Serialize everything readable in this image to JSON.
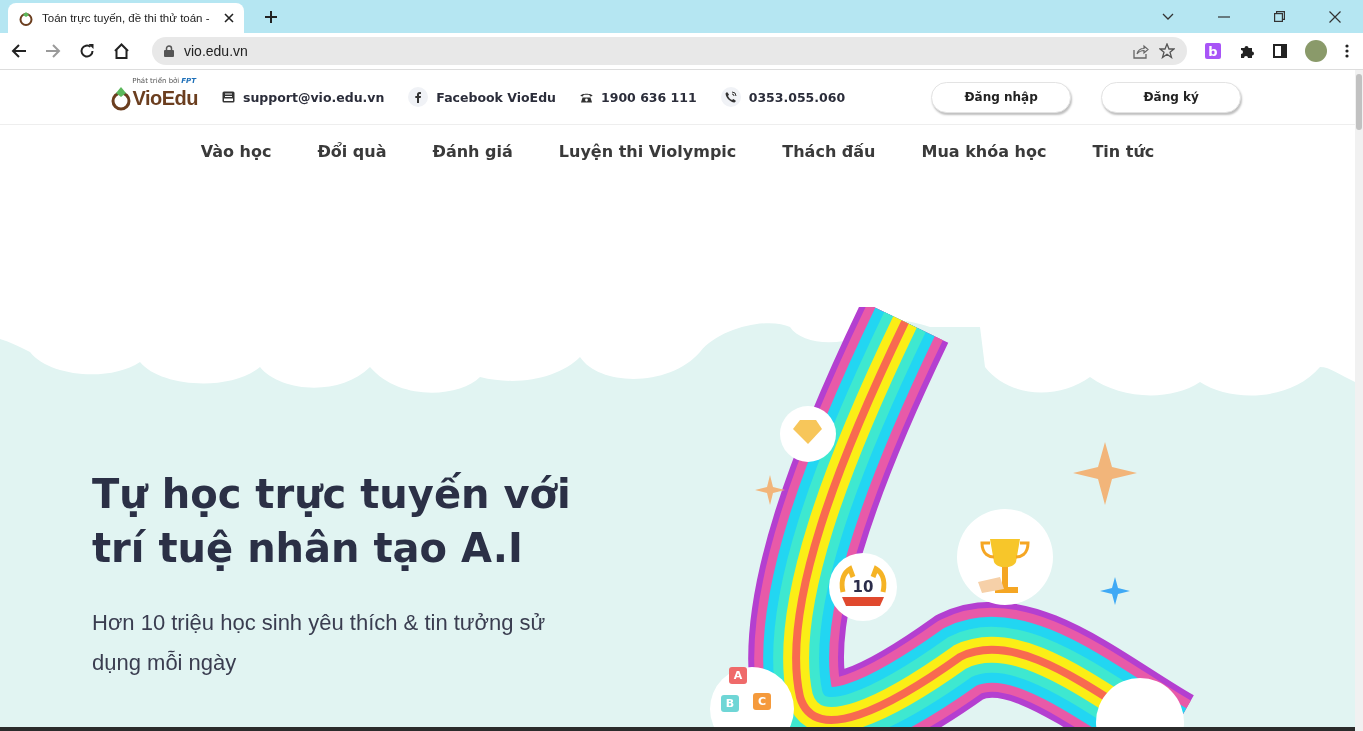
{
  "browser": {
    "tab": {
      "title": "Toán trực tuyến, đề thi thử toán -"
    },
    "nav_buttons": [
      {
        "kind": "back",
        "disabled": false
      },
      {
        "kind": "forward",
        "disabled": true
      },
      {
        "kind": "reload",
        "disabled": false
      },
      {
        "kind": "home",
        "disabled": false
      }
    ],
    "url": "vio.edu.vn",
    "extension_letter": "b"
  },
  "site": {
    "logo": {
      "tagline": "Phát triển bởi",
      "brand": "FPT",
      "name": "VioEdu"
    },
    "contacts": [
      {
        "kind": "email",
        "text": "support@vio.edu.vn"
      },
      {
        "kind": "facebook",
        "text": "Facebook VioEdu"
      },
      {
        "kind": "phone",
        "text": "1900 636 111"
      },
      {
        "kind": "mobile",
        "text": "0353.055.060"
      }
    ],
    "auth_buttons": [
      "Đăng nhập",
      "Đăng ký"
    ],
    "menu": [
      "Vào học",
      "Đổi quà",
      "Đánh giá",
      "Luyện thi Violympic",
      "Thách đấu",
      "Mua khóa học",
      "Tin tức"
    ],
    "hero": {
      "title": "Tự học trực tuyến với trí tuệ nhân tạo A.I",
      "subtitle": "Hơn 10 triệu học sinh yêu thích & tin tưởng sử dụng mỗi ngày",
      "badge_number": "10",
      "blocks": [
        "A",
        "B",
        "C"
      ]
    }
  }
}
